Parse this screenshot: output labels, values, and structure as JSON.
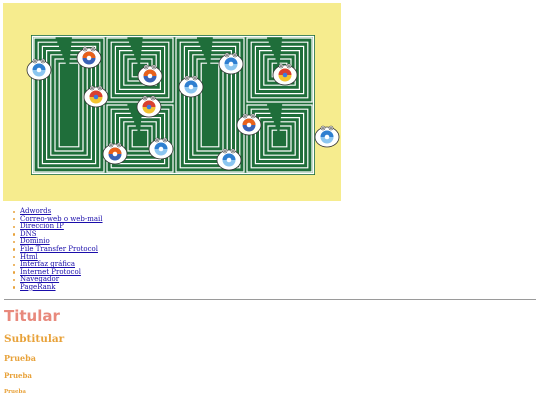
{
  "banner": {
    "background": "#f6ec8e",
    "maze_color": "#1f6e3a",
    "maze_line_color": "#ffffff",
    "characters": [
      "firefox-icon",
      "chrome-icon",
      "internet-explorer-icon"
    ]
  },
  "links": {
    "items": [
      "Adwords",
      "Correo-web o web-mail",
      "Dirección IP",
      "DNS",
      "Dominio",
      "File Transfer Protocol",
      "Html",
      "Interfaz gráfica",
      "Internet Protocol",
      "Navegador",
      "PageRank"
    ],
    "bullet_color": "#e8a23a",
    "link_color": "#1a0dab"
  },
  "headings": {
    "h1": "Titular",
    "h2": "Subtitular",
    "h3": "Prueba",
    "h4": "Prueba",
    "h5": "Prueba"
  },
  "colors": {
    "heading1": "#e8897c",
    "heading_other": "#e8a23a"
  }
}
